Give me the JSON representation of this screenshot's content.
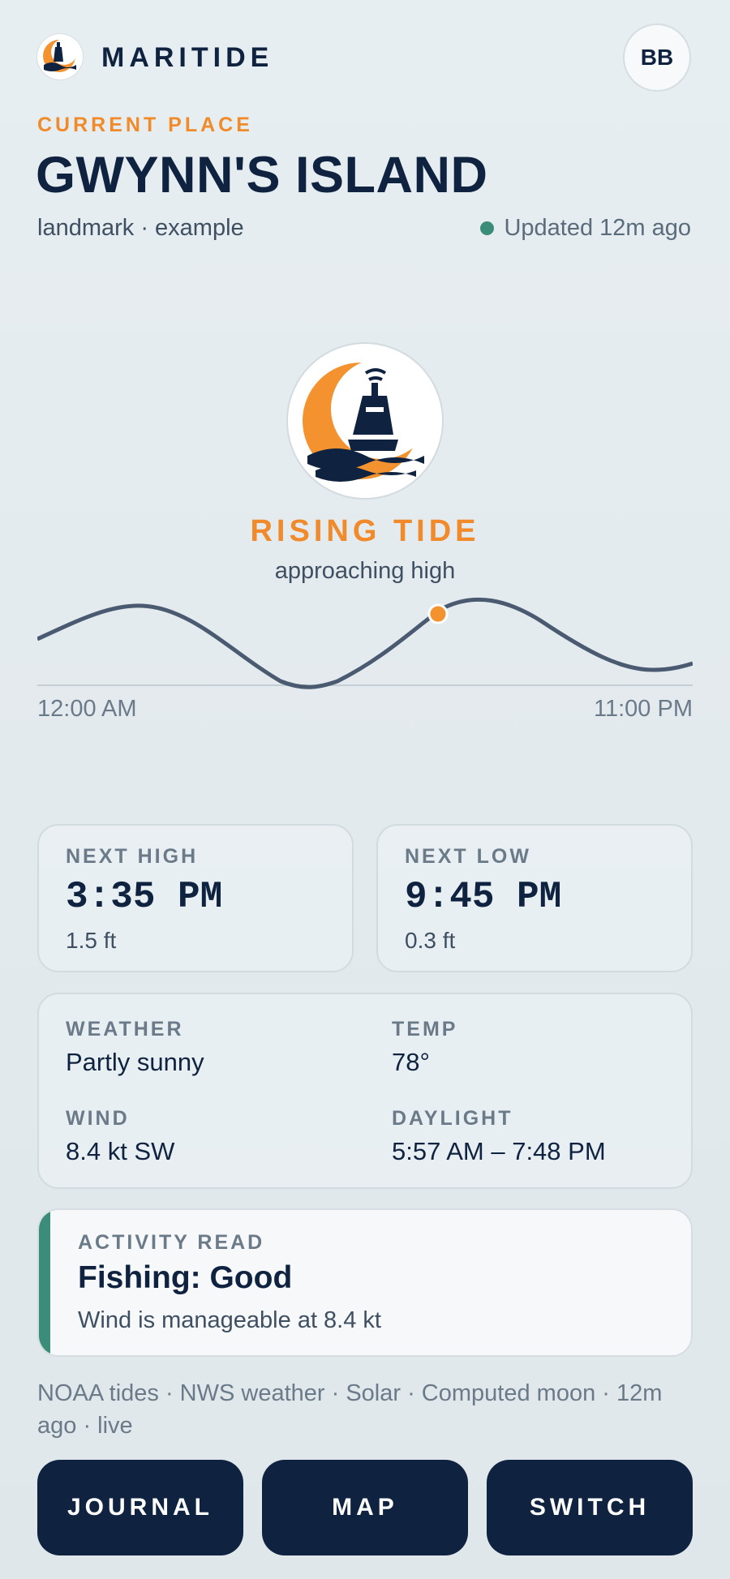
{
  "app": {
    "brand": "MARITIDE",
    "avatar_initials": "BB"
  },
  "place": {
    "eyebrow": "CURRENT PLACE",
    "name": "GWYNN'S ISLAND",
    "subtitle": "landmark · example",
    "updated": "Updated 12m ago"
  },
  "tide": {
    "state": "RISING TIDE",
    "detail": "approaching high",
    "axis_start": "12:00 AM",
    "axis_end": "11:00 PM",
    "current_marker_fraction": 0.61
  },
  "next_high": {
    "label": "NEXT HIGH",
    "time": "3:35 PM",
    "height": "1.5 ft"
  },
  "next_low": {
    "label": "NEXT LOW",
    "time": "9:45 PM",
    "height": "0.3 ft"
  },
  "conditions": {
    "weather_label": "WEATHER",
    "weather": "Partly sunny",
    "temp_label": "TEMP",
    "temp": "78°",
    "wind_label": "WIND",
    "wind": "8.4 kt SW",
    "daylight_label": "DAYLIGHT",
    "daylight": "5:57 AM – 7:48 PM"
  },
  "activity": {
    "label": "ACTIVITY READ",
    "headline": "Fishing: Good",
    "detail": "Wind is manageable at 8.4 kt"
  },
  "sources": "NOAA tides · NWS weather · Solar · Computed moon · 12m ago · live",
  "buttons": {
    "journal": "JOURNAL",
    "map": "MAP",
    "switch": "SWITCH"
  },
  "colors": {
    "accent": "#f08a2a",
    "navy": "#0f2340",
    "status_green": "#3b8c78",
    "curve": "#4a5a70"
  },
  "icons": [
    "maritide-logo-icon",
    "buoy-moon-icon",
    "status-dot-icon"
  ]
}
